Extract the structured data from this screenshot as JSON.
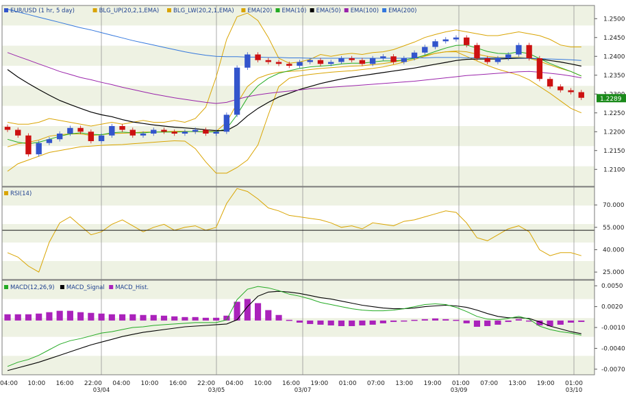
{
  "colors": {
    "plot_bg": "#ffffff",
    "band_bg": "#eef2e3",
    "candle_up": "#3355cc",
    "candle_down": "#cc1111",
    "bollinger": "#d9a400",
    "ema20": "#d9a400",
    "ema10": "#22aa22",
    "ema50": "#000000",
    "ema100": "#9922aa",
    "ema200": "#3377dd",
    "rsi": "#d9a400",
    "macd": "#22aa22",
    "macd_signal": "#000000",
    "macd_hist": "#aa22bb",
    "price_tag_bg": "#1a8a1a",
    "price_tag_text": "#ffffff"
  },
  "price_panel": {
    "legend": [
      {
        "label": "EUR/USD (1 hr,  5 day)",
        "color": "#3355cc"
      },
      {
        "label": "BLG_UP(20,2,1,EMA)",
        "color": "#d9a400"
      },
      {
        "label": "BLG_LW(20,2,1,EMA)",
        "color": "#d9a400"
      },
      {
        "label": "EMA(20)",
        "color": "#d9a400"
      },
      {
        "label": "EMA(10)",
        "color": "#22aa22"
      },
      {
        "label": "EMA(50)",
        "color": "#000000"
      },
      {
        "label": "EMA(100)",
        "color": "#9922aa"
      },
      {
        "label": "EMA(200)",
        "color": "#3377dd"
      }
    ],
    "y_ticks": [
      "1.2500",
      "1.2450",
      "1.2400",
      "1.2350",
      "1.2300",
      "1.2250",
      "1.2200",
      "1.2150",
      "1.2100"
    ],
    "last_price": "1.2289"
  },
  "rsi_panel": {
    "legend": [
      {
        "label": "RSI(14)",
        "color": "#d9a400"
      }
    ],
    "y_ticks": [
      "70.000",
      "55.000",
      "40.000",
      "25.000"
    ]
  },
  "macd_panel": {
    "legend": [
      {
        "label": "MACD(12,26,9)",
        "color": "#22aa22"
      },
      {
        "label": "MACD_Signal",
        "color": "#000000"
      },
      {
        "label": "MACD_Hist.",
        "color": "#aa22bb"
      }
    ],
    "y_ticks": [
      "0.0050",
      "0.0020",
      "-0.0010",
      "-0.0040",
      "-0.0070"
    ]
  },
  "x_axis": {
    "time_labels": [
      "04:00",
      "10:00",
      "16:00",
      "22:00",
      "04:00",
      "10:00",
      "16:00",
      "22:00",
      "04:00",
      "10:00",
      "16:00",
      "19:00",
      "01:00",
      "07:00",
      "13:00",
      "19:00",
      "01:00",
      "07:00",
      "13:00",
      "19:00",
      "01:00"
    ],
    "date_labels": [
      "03/04",
      "03/05",
      "03/07",
      "03/09",
      "03/10"
    ]
  },
  "chart_data": [
    {
      "type": "candlestick",
      "title": "EUR/USD (1 hr,  5 day)",
      "ylim": [
        1.2055,
        1.2535
      ],
      "x_categories": [
        "04:00",
        "10:00",
        "16:00",
        "22:00",
        "04:00",
        "10:00",
        "16:00",
        "22:00",
        "04:00",
        "10:00",
        "16:00",
        "19:00",
        "01:00",
        "07:00",
        "13:00",
        "19:00",
        "01:00",
        "07:00",
        "13:00",
        "19:00",
        "01:00"
      ],
      "date_labels": [
        "03/04",
        "03/05",
        "03/07",
        "03/09",
        "03/10"
      ],
      "close_series": [
        1.2205,
        1.219,
        1.214,
        1.217,
        1.218,
        1.2195,
        1.221,
        1.22,
        1.2175,
        1.219,
        1.2215,
        1.2205,
        1.219,
        1.2195,
        1.2205,
        1.22,
        1.2195,
        1.22,
        1.2205,
        1.2195,
        1.22,
        1.2245,
        1.237,
        1.2405,
        1.239,
        1.2385,
        1.238,
        1.2375,
        1.2385,
        1.239,
        1.238,
        1.2385,
        1.2395,
        1.239,
        1.238,
        1.2395,
        1.24,
        1.2385,
        1.2395,
        1.241,
        1.2425,
        1.244,
        1.2445,
        1.245,
        1.243,
        1.2395,
        1.2385,
        1.2395,
        1.2405,
        1.243,
        1.2395,
        1.234,
        1.232,
        1.231,
        1.2305,
        1.229
      ],
      "series": [
        {
          "name": "BLG_UP(20,2,1,EMA)",
          "values": [
            1.2225,
            1.222,
            1.222,
            1.2225,
            1.2235,
            1.223,
            1.2225,
            1.222,
            1.2215,
            1.222,
            1.2225,
            1.222,
            1.2225,
            1.223,
            1.2225,
            1.2225,
            1.223,
            1.2225,
            1.2235,
            1.2265,
            1.2345,
            1.2445,
            1.2505,
            1.2515,
            1.2495,
            1.245,
            1.2395,
            1.2382,
            1.2385,
            1.2392,
            1.2405,
            1.24,
            1.2405,
            1.2408,
            1.2405,
            1.241,
            1.2412,
            1.2418,
            1.2428,
            1.2438,
            1.245,
            1.2458,
            1.2465,
            1.247,
            1.2465,
            1.246,
            1.2455,
            1.2455,
            1.246,
            1.2465,
            1.246,
            1.2455,
            1.2445,
            1.243,
            1.2425,
            1.2425
          ]
        },
        {
          "name": "BLG_LW(20,2,1,EMA)",
          "values": [
            1.2095,
            1.2115,
            1.2125,
            1.2135,
            1.2145,
            1.215,
            1.2155,
            1.216,
            1.2162,
            1.2164,
            1.2165,
            1.2166,
            1.2168,
            1.217,
            1.2172,
            1.2174,
            1.2176,
            1.2175,
            1.2155,
            1.212,
            1.209,
            1.209,
            1.2105,
            1.2125,
            1.2165,
            1.2245,
            1.232,
            1.2342,
            1.2348,
            1.2352,
            1.2355,
            1.2358,
            1.236,
            1.2362,
            1.2365,
            1.2368,
            1.2372,
            1.2378,
            1.2385,
            1.2392,
            1.24,
            1.2408,
            1.2412,
            1.2412,
            1.24,
            1.2388,
            1.2376,
            1.2366,
            1.2358,
            1.235,
            1.2338,
            1.232,
            1.2302,
            1.2282,
            1.2262,
            1.225
          ]
        },
        {
          "name": "EMA(20)",
          "values": [
            1.216,
            1.2168,
            1.2172,
            1.2178,
            1.2188,
            1.2192,
            1.2194,
            1.2194,
            1.219,
            1.2192,
            1.2195,
            1.2196,
            1.2197,
            1.2199,
            1.2199,
            1.22,
            1.2201,
            1.2201,
            1.22,
            1.22,
            1.2201,
            1.2225,
            1.2275,
            1.232,
            1.2342,
            1.2352,
            1.2358,
            1.236,
            1.2362,
            1.2365,
            1.2368,
            1.237,
            1.2372,
            1.2374,
            1.2375,
            1.2378,
            1.2381,
            1.2385,
            1.239,
            1.2396,
            1.2402,
            1.2408,
            1.2412,
            1.2414,
            1.2412,
            1.2406,
            1.24,
            1.2397,
            1.2397,
            1.2398,
            1.2395,
            1.2387,
            1.2377,
            1.2368,
            1.236,
            1.2348
          ]
        },
        {
          "name": "EMA(10)",
          "values": [
            1.218,
            1.2172,
            1.2168,
            1.2172,
            1.218,
            1.2188,
            1.2194,
            1.2197,
            1.2193,
            1.2192,
            1.2197,
            1.2199,
            1.2197,
            1.2197,
            1.2199,
            1.2199,
            1.2199,
            1.22,
            1.2201,
            1.2199,
            1.22,
            1.2208,
            1.2245,
            1.229,
            1.2322,
            1.2342,
            1.2355,
            1.2362,
            1.2368,
            1.2372,
            1.2374,
            1.2376,
            1.238,
            1.2382,
            1.2382,
            1.2385,
            1.2388,
            1.2388,
            1.239,
            1.2395,
            1.2403,
            1.2413,
            1.2422,
            1.2429,
            1.243,
            1.2422,
            1.2413,
            1.2408,
            1.2407,
            1.2412,
            1.2407,
            1.2394,
            1.2381,
            1.237,
            1.236,
            1.2348
          ]
        },
        {
          "name": "EMA(50)",
          "values": [
            1.2365,
            1.2345,
            1.2328,
            1.2312,
            1.2297,
            1.2283,
            1.2272,
            1.2262,
            1.2252,
            1.2245,
            1.224,
            1.2232,
            1.2226,
            1.2222,
            1.2218,
            1.2215,
            1.2212,
            1.221,
            1.2208,
            1.2205,
            1.2203,
            1.2203,
            1.2218,
            1.2242,
            1.2262,
            1.2278,
            1.2292,
            1.2302,
            1.2312,
            1.232,
            1.2328,
            1.2334,
            1.234,
            1.2345,
            1.2349,
            1.2353,
            1.2357,
            1.2361,
            1.2365,
            1.2369,
            1.2374,
            1.2379,
            1.2384,
            1.2389,
            1.2392,
            1.2393,
            1.2393,
            1.2393,
            1.2394,
            1.2395,
            1.2395,
            1.2393,
            1.2389,
            1.2385,
            1.238,
            1.2374
          ]
        },
        {
          "name": "EMA(100)",
          "values": [
            1.241,
            1.24,
            1.239,
            1.238,
            1.237,
            1.236,
            1.2352,
            1.2344,
            1.2338,
            1.2331,
            1.2325,
            1.2318,
            1.2312,
            1.2306,
            1.23,
            1.2295,
            1.229,
            1.2286,
            1.2282,
            1.2278,
            1.2275,
            1.2278,
            1.2286,
            1.2293,
            1.2298,
            1.2302,
            1.2305,
            1.2308,
            1.2311,
            1.2314,
            1.2316,
            1.2318,
            1.232,
            1.2322,
            1.2324,
            1.2326,
            1.2328,
            1.233,
            1.2332,
            1.2334,
            1.2337,
            1.234,
            1.2343,
            1.2346,
            1.2349,
            1.2351,
            1.2353,
            1.2355,
            1.2357,
            1.2359,
            1.236,
            1.2358,
            1.2355,
            1.2352,
            1.2348,
            1.2343
          ]
        },
        {
          "name": "EMA(200)",
          "values": [
            1.2525,
            1.2518,
            1.2511,
            1.2504,
            1.2497,
            1.249,
            1.2483,
            1.2476,
            1.247,
            1.2463,
            1.2456,
            1.2449,
            1.2442,
            1.2436,
            1.243,
            1.2424,
            1.2418,
            1.2412,
            1.2407,
            1.2403,
            1.24,
            1.2399,
            1.2399,
            1.2398,
            1.2398,
            1.2397,
            1.2397,
            1.2396,
            1.2396,
            1.2395,
            1.2395,
            1.2395,
            1.2395,
            1.2395,
            1.2395,
            1.2395,
            1.2395,
            1.2395,
            1.2395,
            1.2396,
            1.2396,
            1.2397,
            1.2397,
            1.2397,
            1.2396,
            1.2396,
            1.2396,
            1.2396,
            1.2396,
            1.2396,
            1.2395,
            1.2394,
            1.2393,
            1.2392,
            1.2391,
            1.2389
          ]
        }
      ]
    },
    {
      "type": "line",
      "title": "RSI(14)",
      "ylim": [
        20,
        82
      ],
      "series": [
        {
          "name": "RSI(14)",
          "values": [
            38,
            35,
            29,
            25,
            45,
            58,
            62,
            56,
            50,
            52,
            57,
            60,
            56,
            52,
            55,
            57,
            53,
            55,
            56,
            53,
            55,
            71,
            81,
            79,
            74,
            68,
            66,
            63,
            62,
            61,
            60,
            58,
            55,
            56,
            54,
            58,
            57,
            56,
            59,
            60,
            62,
            64,
            66,
            65,
            58,
            48,
            46,
            50,
            54,
            56,
            52,
            40,
            36,
            38,
            38,
            36
          ]
        }
      ]
    },
    {
      "type": "line",
      "title": "MACD(12,26,9)",
      "ylim": [
        -0.0078,
        0.0058
      ],
      "series": [
        {
          "name": "MACD(12,26,9)",
          "values": [
            -0.0066,
            -0.006,
            -0.0056,
            -0.005,
            -0.0042,
            -0.0034,
            -0.0029,
            -0.0026,
            -0.0022,
            -0.0018,
            -0.0016,
            -0.0013,
            -0.001,
            -0.0009,
            -0.0007,
            -0.0006,
            -0.0005,
            -0.0004,
            -0.0003,
            -0.0003,
            -0.0003,
            0.0001,
            0.003,
            0.0045,
            0.0049,
            0.0047,
            0.0043,
            0.0038,
            0.0035,
            0.0031,
            0.0026,
            0.0023,
            0.002,
            0.0017,
            0.0015,
            0.0014,
            0.0014,
            0.0015,
            0.0017,
            0.002,
            0.0023,
            0.0024,
            0.0023,
            0.0019,
            0.0013,
            0.0006,
            0.0002,
            0.0001,
            0.0003,
            0.0006,
            0.0002,
            -0.0008,
            -0.0013,
            -0.0016,
            -0.0018,
            -0.0021
          ]
        },
        {
          "name": "MACD_Signal",
          "values": [
            -0.0072,
            -0.0068,
            -0.0064,
            -0.006,
            -0.0055,
            -0.005,
            -0.0045,
            -0.004,
            -0.0035,
            -0.0031,
            -0.0027,
            -0.0023,
            -0.002,
            -0.0017,
            -0.0015,
            -0.0013,
            -0.0011,
            -0.0009,
            -0.0008,
            -0.0007,
            -0.0006,
            -0.0005,
            0.0001,
            0.002,
            0.0035,
            0.0041,
            0.0042,
            0.0041,
            0.0039,
            0.0036,
            0.0033,
            0.0031,
            0.0028,
            0.0025,
            0.0022,
            0.002,
            0.0018,
            0.0017,
            0.0017,
            0.0018,
            0.002,
            0.0021,
            0.0022,
            0.0021,
            0.0019,
            0.0015,
            0.001,
            0.0006,
            0.0004,
            0.0004,
            0.0003,
            -0.0002,
            -0.0008,
            -0.0012,
            -0.0016,
            -0.0019
          ]
        },
        {
          "name": "MACD_Hist.",
          "values": [
            0.0009,
            0.0009,
            0.0009,
            0.001,
            0.0012,
            0.0014,
            0.0014,
            0.0012,
            0.0011,
            0.001,
            0.0009,
            0.0009,
            0.0009,
            0.0008,
            0.0008,
            0.0007,
            0.0006,
            0.0005,
            0.0005,
            0.0004,
            0.0004,
            0.0007,
            0.0027,
            0.0031,
            0.0025,
            0.0015,
            0.0008,
            0.0001,
            -0.0003,
            -0.0005,
            -0.0006,
            -0.0007,
            -0.0008,
            -0.0008,
            -0.0007,
            -0.0006,
            -0.0004,
            -0.0002,
            -0.0001,
            0.0001,
            0.0002,
            0.0003,
            0.0002,
            0.0001,
            -0.0004,
            -0.0009,
            -0.0008,
            -0.0006,
            -0.0002,
            0.0002,
            -0.0001,
            -0.0007,
            -0.0008,
            -0.0006,
            -0.0003,
            -0.0002
          ]
        }
      ]
    }
  ]
}
